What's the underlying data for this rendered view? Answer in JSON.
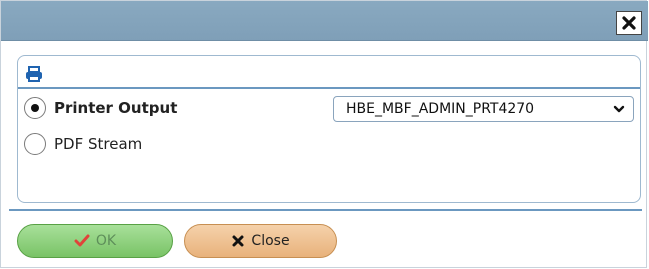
{
  "dialog": {
    "close_icon": "close-x-icon"
  },
  "panel": {
    "header_icon": "printer-icon",
    "options": [
      {
        "label": "Printer Output",
        "selected": true
      },
      {
        "label": "PDF Stream",
        "selected": false
      }
    ],
    "printer_select": {
      "value": "HBE_MBF_ADMIN_PRT4270"
    }
  },
  "buttons": {
    "ok_label": "OK",
    "close_label": "Close"
  },
  "colors": {
    "titlebar": "#86a6be",
    "accent_blue": "#2a6fb5",
    "ok_green": "#79c366",
    "close_orange": "#e8b27b"
  }
}
